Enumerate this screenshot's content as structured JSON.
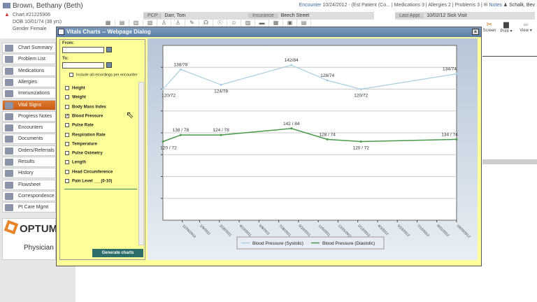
{
  "patient": {
    "name": "Brown, Bethany (Beth)",
    "chart": "Chart #21225906",
    "dob": "DOB 10/01/74 (38 yrs)",
    "gender": "Gender Female"
  },
  "header": {
    "pcp_label": "PCP",
    "pcp": "Darr, Tom",
    "insurance_label": "Insurance",
    "insurance": "Beech Street",
    "last_appt_label": "Last Appt",
    "last_appt": "10/02/12 Sick Visit",
    "encounter_label": "Encounter",
    "encounter": "10/24/2012 - (Est Patient (Co...",
    "medications": "Medications 3",
    "allergies": "Allergies 2",
    "problems": "Problems 3",
    "notes": "Notes",
    "user": "Schalk, Bev",
    "screen": "Screen",
    "print": "Print",
    "view": "View"
  },
  "sidebar": {
    "items": [
      "Chart Summary",
      "Problem List",
      "Medications",
      "Allergies",
      "Immunizations",
      "Vital Signs",
      "Progress Notes",
      "Encounters",
      "Documents",
      "Orders/Referrals",
      "Results",
      "History",
      "Flowsheet",
      "Correspondence",
      "Pt Care Mgmt"
    ],
    "selected": "Vital Signs",
    "logo_text": "OPTUM",
    "logo_sub": "Physician"
  },
  "dialog": {
    "title": "Vitals Charts -- Webpage Dialog",
    "from_label": "From:",
    "to_label": "To:",
    "from_value": "",
    "to_value": "",
    "include_all": "Include all recordings per encounter",
    "vitals": [
      {
        "label": "Height",
        "checked": false
      },
      {
        "label": "Weight",
        "checked": false
      },
      {
        "label": "Body Mass Index",
        "checked": false
      },
      {
        "label": "Blood Pressure",
        "checked": true
      },
      {
        "label": "Pulse Rate",
        "checked": false
      },
      {
        "label": "Respiration Rate",
        "checked": false
      },
      {
        "label": "Temperature",
        "checked": false
      },
      {
        "label": "Pulse Oximetry",
        "checked": false
      },
      {
        "label": "Length",
        "checked": false
      },
      {
        "label": "Head Circumference",
        "checked": false
      },
      {
        "label": "Pain Level ___(0-10)",
        "checked": false
      }
    ],
    "generate": "Generate charts"
  },
  "chart_data": {
    "type": "line",
    "ylim": [
      0,
      160
    ],
    "grid": true,
    "legend_placement": "bottom",
    "xticks": [
      "11/26/2010",
      "1/9/2011",
      "2/28/2011",
      "4/19/2011",
      "6/8/2011",
      "7/28/2011",
      "9/16/2011",
      "11/5/2011",
      "12/25/2011",
      "2/13/2012",
      "4/3/2012",
      "5/23/2012",
      "7/12/2012",
      "8/31/2012",
      "10/20/2012"
    ],
    "x": [
      "2010-10-08",
      "2010-11-22",
      "2011-03-04",
      "2011-08-29",
      "2011-11-28",
      "2012-02-21",
      "2012-10-20"
    ],
    "labels_systolic": [
      "120/72",
      "138/78",
      "124/78",
      "142/84",
      "128/74",
      "120/72",
      "134/74"
    ],
    "labels_diastolic": [
      "120 / 72",
      "138 / 78",
      "124 / 78",
      "142 / 84",
      "128 / 74",
      "120 / 72",
      "134 / 74"
    ],
    "series": [
      {
        "name": "Blood Pressure (Systolic)",
        "values": [
          120,
          138,
          124,
          142,
          128,
          120,
          134
        ],
        "color": "#a8cfe0"
      },
      {
        "name": "Blood Pressure (Diastolic)",
        "values": [
          72,
          78,
          78,
          84,
          74,
          72,
          74
        ],
        "color": "#4a9a4a"
      }
    ]
  }
}
